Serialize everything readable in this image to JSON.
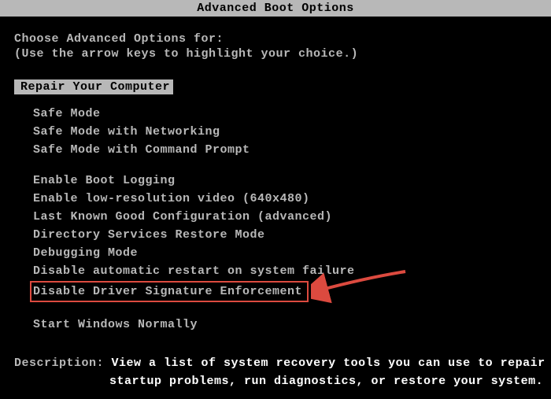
{
  "title": "Advanced Boot Options",
  "instruction1": "Choose Advanced Options for:",
  "instruction2": "(Use the arrow keys to highlight your choice.)",
  "selected_item": "Repair Your Computer",
  "options": {
    "group1": [
      "Safe Mode",
      "Safe Mode with Networking",
      "Safe Mode with Command Prompt"
    ],
    "group2": [
      "Enable Boot Logging",
      "Enable low-resolution video (640x480)",
      "Last Known Good Configuration (advanced)",
      "Directory Services Restore Mode",
      "Debugging Mode",
      "Disable automatic restart on system failure",
      "Disable Driver Signature Enforcement"
    ],
    "group3": [
      "Start Windows Normally"
    ]
  },
  "highlighted_index": 6,
  "description": {
    "label": "Description: ",
    "text1": "View a list of system recovery tools you can use to repair",
    "text2": "startup problems, run diagnostics, or restore your system."
  }
}
